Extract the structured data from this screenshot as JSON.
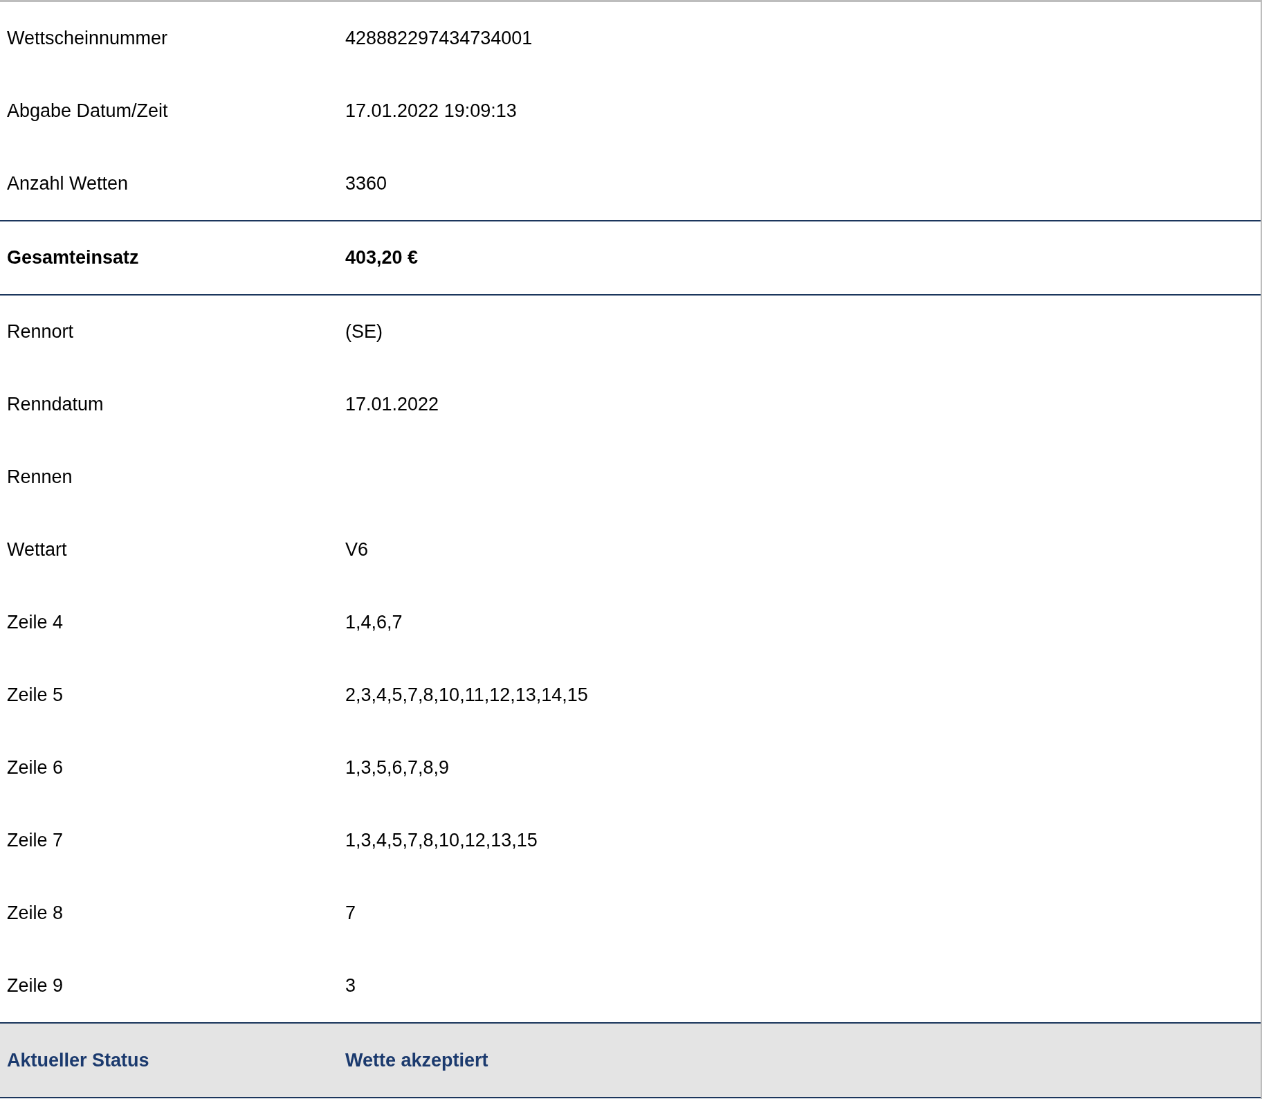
{
  "rows": [
    {
      "kind": "normal",
      "label": "Wettscheinnummer",
      "value": "428882297434734001"
    },
    {
      "kind": "normal",
      "label": "Abgabe Datum/Zeit",
      "value": "17.01.2022 19:09:13"
    },
    {
      "kind": "normal",
      "label": "Anzahl Wetten",
      "value": "3360"
    },
    {
      "kind": "total",
      "label": "Gesamteinsatz",
      "value": "403,20 €"
    },
    {
      "kind": "normal",
      "label": "Rennort",
      "value": "(SE)"
    },
    {
      "kind": "normal",
      "label": "Renndatum",
      "value": "17.01.2022"
    },
    {
      "kind": "normal",
      "label": "Rennen"
    },
    {
      "kind": "normal",
      "label": "Wettart",
      "value": "V6"
    },
    {
      "kind": "normal",
      "label": "Zeile 4",
      "value": "1,4,6,7"
    },
    {
      "kind": "normal",
      "label": "Zeile 5",
      "value": "2,3,4,5,7,8,10,11,12,13,14,15"
    },
    {
      "kind": "normal",
      "label": "Zeile 6",
      "value": "1,3,5,6,7,8,9"
    },
    {
      "kind": "normal",
      "label": "Zeile 7",
      "value": "1,3,4,5,7,8,10,12,13,15"
    },
    {
      "kind": "normal",
      "label": "Zeile 8",
      "value": "7"
    },
    {
      "kind": "normal",
      "label": "Zeile 9",
      "value": "3"
    },
    {
      "kind": "status",
      "label": "Aktueller Status",
      "value": "Wette akzeptiert"
    }
  ]
}
